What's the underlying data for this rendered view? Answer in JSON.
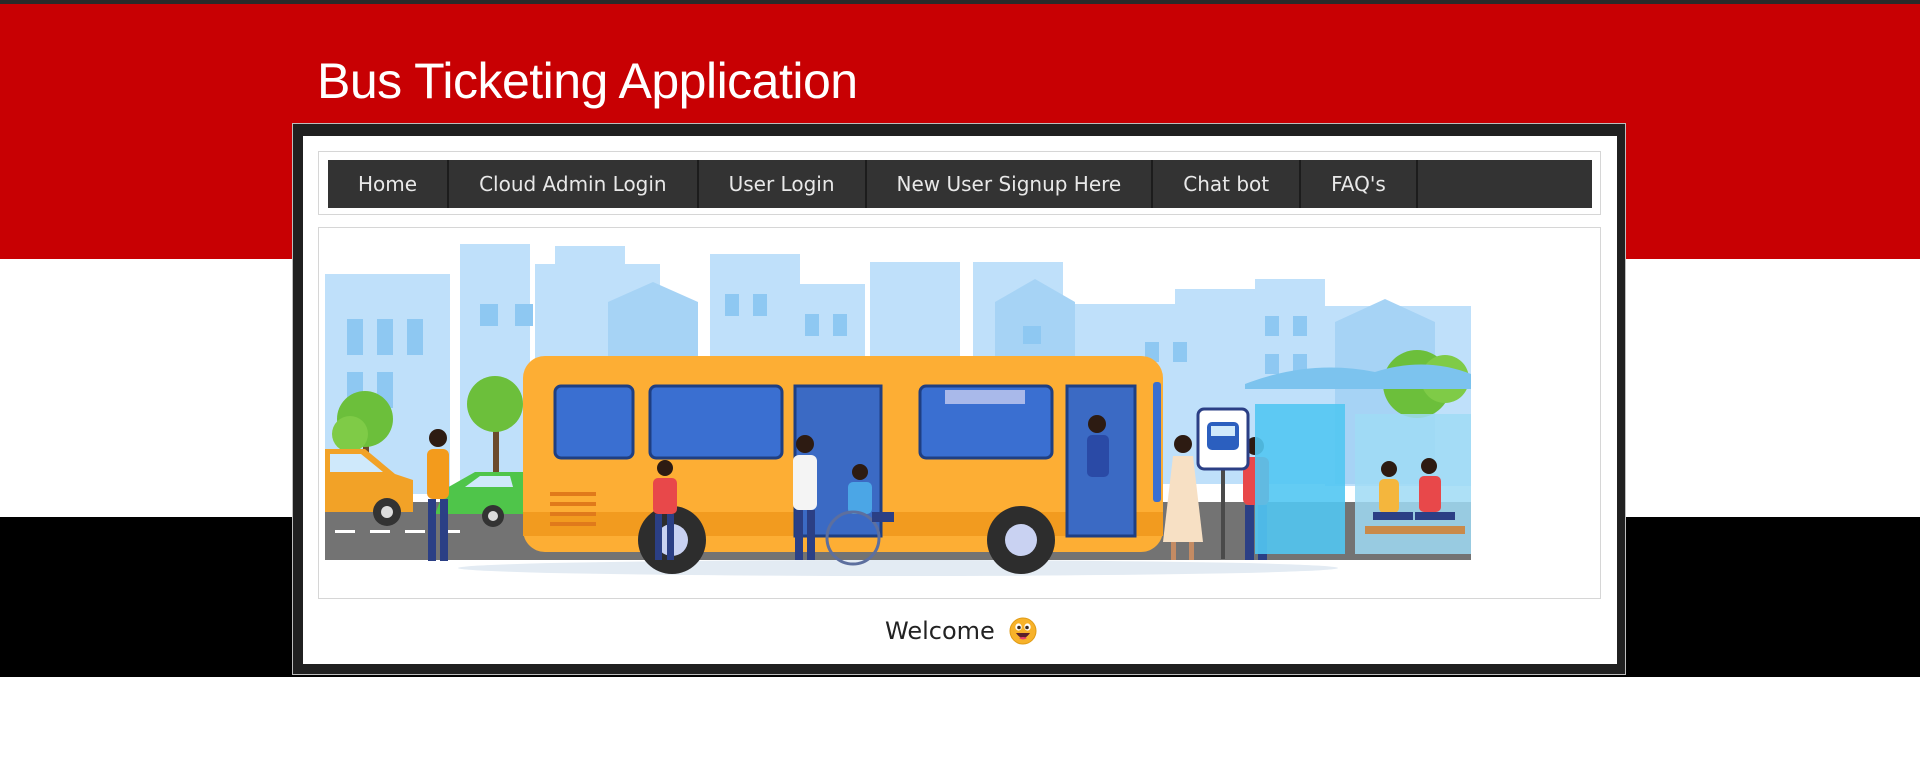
{
  "header": {
    "title": "Bus Ticketing Application"
  },
  "nav": {
    "items": [
      {
        "label": "Home"
      },
      {
        "label": "Cloud Admin Login"
      },
      {
        "label": "User Login"
      },
      {
        "label": "New User Signup Here"
      },
      {
        "label": "Chat bot"
      },
      {
        "label": "FAQ's"
      }
    ]
  },
  "banner": {
    "icon": "bus-stop-illustration"
  },
  "welcome": {
    "text": "Welcome",
    "icon": "grinning-face-emoji-icon"
  },
  "colors": {
    "accent_red": "#c80003",
    "nav_bg": "#333333",
    "bus_yellow": "#fdae34",
    "sky_blue": "#b9dcf7"
  }
}
